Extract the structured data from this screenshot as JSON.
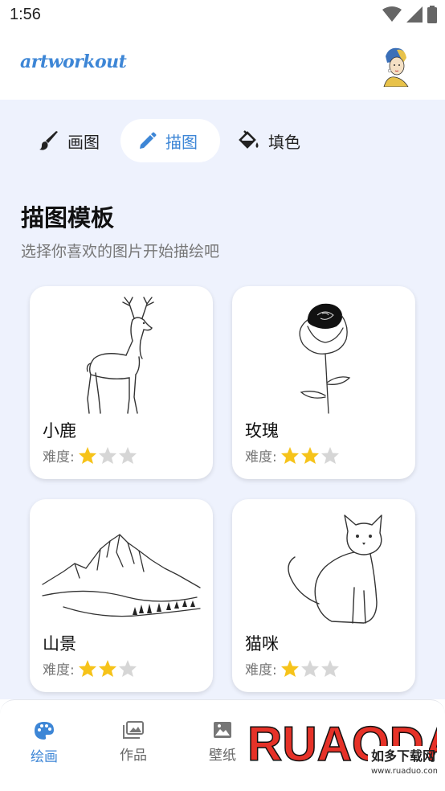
{
  "status_bar": {
    "time": "1:56"
  },
  "header": {
    "logo": "artworkout"
  },
  "tabs": [
    {
      "label": "画图",
      "icon": "brush-icon"
    },
    {
      "label": "描图",
      "icon": "pencil-icon"
    },
    {
      "label": "填色",
      "icon": "paint-bucket-icon"
    }
  ],
  "section": {
    "title": "描图模板",
    "subtitle": "选择你喜欢的图片开始描绘吧"
  },
  "difficulty_label": "难度:",
  "cards": [
    {
      "name": "小鹿",
      "difficulty": 1
    },
    {
      "name": "玫瑰",
      "difficulty": 2
    },
    {
      "name": "山景",
      "difficulty": 2
    },
    {
      "name": "猫咪",
      "difficulty": 1
    }
  ],
  "bottom_nav": [
    {
      "label": "绘画",
      "icon": "palette-icon"
    },
    {
      "label": "作品",
      "icon": "gallery-icon"
    },
    {
      "label": "壁纸",
      "icon": "image-icon"
    }
  ],
  "watermark": {
    "brand": "RUAODAO",
    "tagline": "如多下载网",
    "url": "www.ruaduo.com"
  },
  "colors": {
    "accent": "#3d86d6",
    "background": "#eef2fd",
    "star_on": "#f6c31a",
    "star_off": "#d6d6d6"
  }
}
